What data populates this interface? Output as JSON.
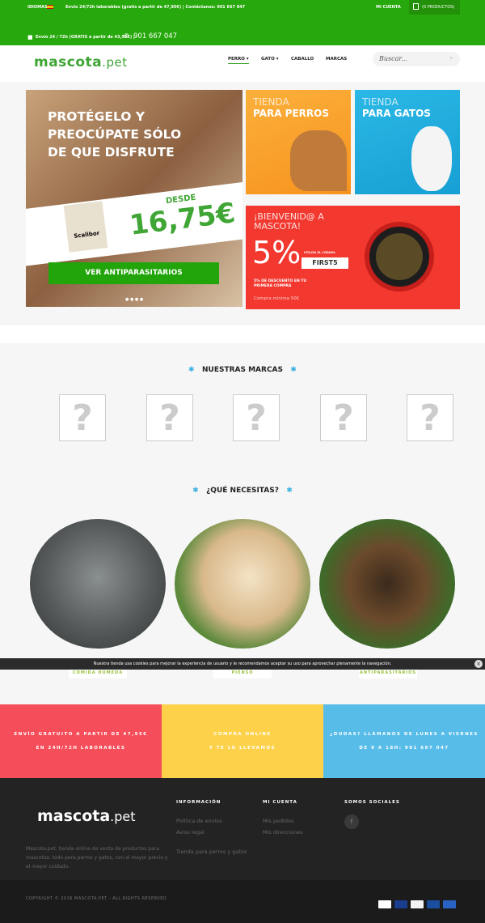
{
  "topbar": {
    "idiomas": "IDIOMAS:",
    "shipping_info": "Envío 24/72h laborables (gratis a partir de 47,95€) | Contáctanos: 901 667 047",
    "account": "MI CUENTA",
    "cart": "(0 PRODUCTOS)",
    "shipping2": "Envío 24 / 72h (GRATIS a partir de 43,95€) |",
    "phone": "901 667 047"
  },
  "header": {
    "logo_main": "mascota",
    "logo_suffix": ".pet",
    "nav": [
      "PERRO",
      "GATO",
      "CABALLO",
      "MARCAS"
    ],
    "search_placeholder": "Buscar..."
  },
  "hero": {
    "headline": "PROTÉGELO Y PREOCÚPATE SÓLO DE QUE DISFRUTE",
    "desde": "DESDE",
    "price": "16,75€",
    "brand": "Scalibor",
    "cta": "VER ANTIPARASITARIOS"
  },
  "tiles": {
    "perros": [
      "TIENDA",
      "PARA PERROS"
    ],
    "gatos": [
      "TIENDA",
      "PARA GATOS"
    ]
  },
  "promo": {
    "title": "¡BIENVENID@ A MASCOTA!",
    "percent": "5%",
    "code_label": "UTILIZA EL CÓDIGO:",
    "code": "FIRST5",
    "desc": "5% DE DESCUENTO EN TU PRIMERA COMPRA",
    "min": "Compra mínima 50€"
  },
  "brands": {
    "title": "NUESTRAS MARCAS",
    "placeholder": "?"
  },
  "needs": {
    "title": "¿QUÉ NECESITAS?",
    "items": [
      "COMIDA HÚMEDA",
      "PIENSO",
      "ANTIPARASITARIOS"
    ]
  },
  "cookie": {
    "text": "Nuestra tienda usa cookies para mejorar la experiencia de usuario y le recomendamos aceptar su uso para aprovechar plenamente la navegación."
  },
  "bands": [
    [
      "ENVÍO GRATUITO A PARTIR DE 47,95€",
      "EN 24H/72H LABORABLES"
    ],
    [
      "COMPRA ONLINE",
      "Y TE LO LLEVAMOS"
    ],
    [
      "¿DUDAS? LLÁMANOS DE LUNES A VIERNES",
      "DE 9 A 18H: 901 667 047"
    ]
  ],
  "footer": {
    "description": "Mascota.pet, tienda online de venta de productos para mascotas: todo para perros y gatos, con el mayor precio y el mayor cuidado.",
    "info_title": "INFORMACIÓN",
    "info_links": [
      "Política de envíos",
      "Aviso legal",
      "Tienda para perros y gatos"
    ],
    "account_title": "MI CUENTA",
    "account_links": [
      "Mis pedidos",
      "Mis direcciones"
    ],
    "social_title": "SOMOS SOCIALES",
    "social_icon": "f",
    "copyright": "COPYRIGHT © 2016 MASCOTA.PET - ALL RIGHTS RESERVED",
    "payments": [
      "VISA",
      "MasterCard",
      "PayPal",
      "Visa Electron",
      "Maestro"
    ]
  }
}
